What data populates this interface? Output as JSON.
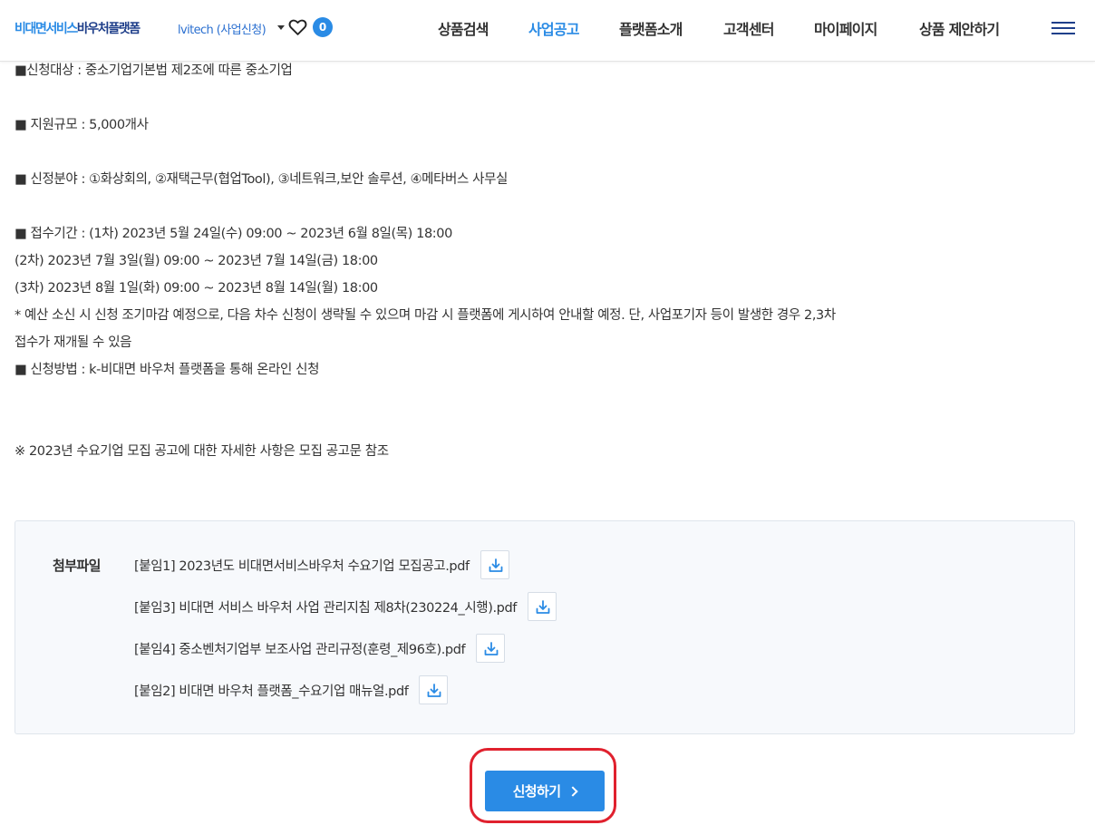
{
  "header": {
    "logo_part1": "비대면서비스",
    "logo_part2": "바우처플랫폼",
    "user_label": "lvitech (사업신청)",
    "wishlist_count": "0",
    "nav": [
      {
        "label": "상품검색"
      },
      {
        "label": "사업공고"
      },
      {
        "label": "플랫폼소개"
      },
      {
        "label": "고객센터"
      },
      {
        "label": "마이페이지"
      },
      {
        "label": "상품 제안하기"
      }
    ],
    "active_nav": "사업공고"
  },
  "notice": {
    "lines": [
      "■신청대상 : 중소기업기본법 제2조에 따른 중소기업",
      "■ 지원규모 : 5,000개사",
      "■ 신정분야 : ①화상회의, ②재택근무(협업Tool), ③네트워크,보안 솔루션, ④메타버스 사무실",
      "■ 접수기간 : (1차) 2023년 5월 24일(수) 09:00 ~ 2023년 6월 8일(목) 18:00",
      "(2차) 2023년 7월 3일(월) 09:00 ~ 2023년 7월 14일(금) 18:00",
      "(3차) 2023년 8월 1일(화) 09:00 ~ 2023년 8월 14일(월) 18:00",
      "* 예산 소신 시 신청 조기마감 예정으로, 다음 차수 신청이 생략될 수 있으며 마감 시 플랫폼에 게시하여 안내할 예정. 단, 사업포기자 등이 발생한 경우 2,3차",
      "접수가 재개될 수 있음",
      "■ 신청방법 : k-비대면 바우처 플랫폼을 통해 온라인 신청",
      "※ 2023년 수요기업 모집 공고에 대한 자세한 사항은 모집 공고문 참조"
    ]
  },
  "attachments": {
    "title": "첨부파일",
    "files": [
      {
        "name": "[붙임1] 2023년도 비대면서비스바우처 수요기업 모집공고.pdf"
      },
      {
        "name": "[붙임3] 비대면 서비스 바우처 사업 관리지침 제8차(230224_시행).pdf"
      },
      {
        "name": "[붙임4] 중소벤처기업부 보조사업 관리규정(훈령_제96호).pdf"
      },
      {
        "name": "[붙임2] 비대면 바우처 플랫폼_수요기업 매뉴얼.pdf"
      }
    ]
  },
  "apply_button": {
    "label": "신청하기"
  },
  "colors": {
    "accent": "#2a8be5",
    "brand_dark": "#1f3f8a",
    "highlight_ring": "#e0212e"
  }
}
